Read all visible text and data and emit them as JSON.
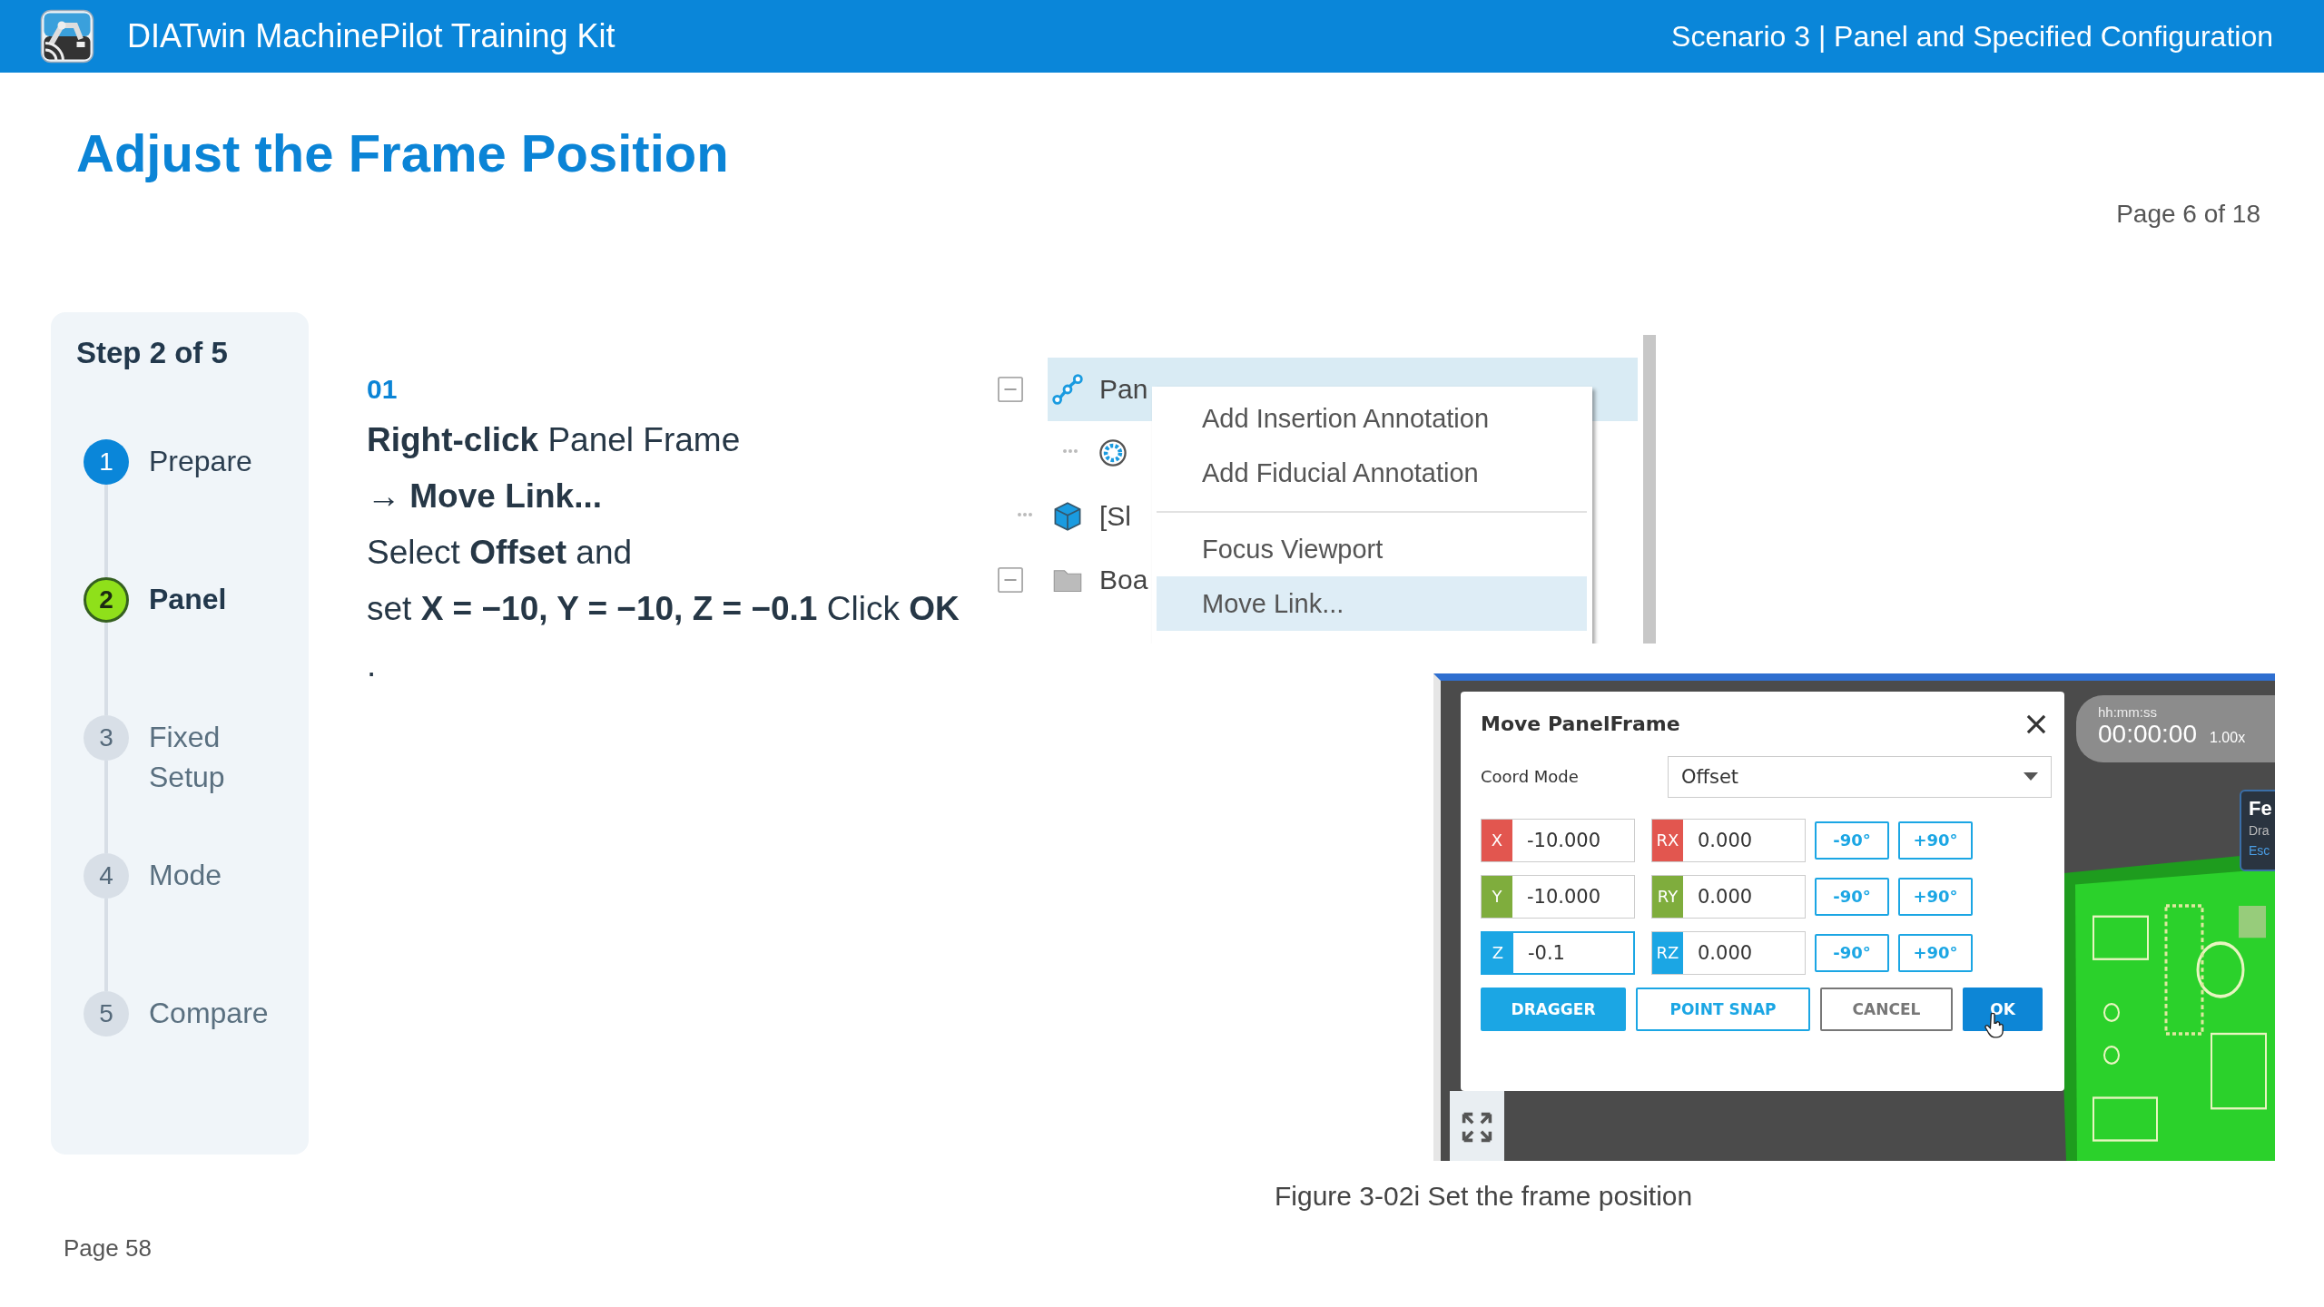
{
  "header": {
    "title": "DIATwin MachinePilot Training Kit",
    "scenario": "Scenario 3 | Panel and Specified Configuration"
  },
  "page_title": "Adjust the Frame Position",
  "page_indicator": "Page 6 of 18",
  "stepper": {
    "title": "Step 2 of 5",
    "steps": [
      {
        "number": "1",
        "label": "Prepare",
        "kind": "done"
      },
      {
        "number": "2",
        "label": "Panel",
        "kind": "current"
      },
      {
        "number": "3",
        "label": "Fixed Setup",
        "kind": "todo"
      },
      {
        "number": "4",
        "label": "Mode",
        "kind": "todo"
      },
      {
        "number": "5",
        "label": "Compare",
        "kind": "todo"
      }
    ]
  },
  "instruction": {
    "number": "01",
    "lines": [
      "**Right-click** Panel Frame",
      "→ **Move Link...**",
      "Select **Offset** and",
      "set **X = −10, Y = −10, Z = −0.1** Click **OK**",
      "."
    ]
  },
  "tree_figure": {
    "rows": [
      {
        "label": "Pan",
        "kind": "link",
        "expander": true,
        "selected": true,
        "children": [
          {
            "kind": "gear",
            "expander": false,
            "selected": false
          }
        ]
      },
      {
        "label": "[Sl",
        "kind": "cube",
        "expander": false,
        "selected": false
      },
      {
        "label": "Boa",
        "kind": "folder",
        "expander": true,
        "selected": false
      }
    ],
    "menu": [
      {
        "label": "Add Insertion Annotation",
        "selected": false,
        "separator_before": false
      },
      {
        "label": "Add Fiducial Annotation",
        "selected": false,
        "separator_before": false
      },
      {
        "label": "Focus Viewport",
        "selected": false,
        "separator_before": true
      },
      {
        "label": "Move Link...",
        "selected": true,
        "separator_before": false
      }
    ]
  },
  "dialog_figure": {
    "title": "Move PanelFrame",
    "coord_mode": {
      "label": "Coord Mode",
      "value": "Offset"
    },
    "axes": [
      {
        "axis": "X",
        "value": "-10.000",
        "color": "#e2564f",
        "focused": false,
        "rot_axis": "RX",
        "rot_value": "0.000",
        "minus": "-90°",
        "plus": "+90°"
      },
      {
        "axis": "Y",
        "value": "-10.000",
        "color": "#7fad3d",
        "focused": false,
        "rot_axis": "RY",
        "rot_value": "0.000",
        "minus": "-90°",
        "plus": "+90°"
      },
      {
        "axis": "Z",
        "value": "-0.1",
        "color": "#1ba6e4",
        "focused": true,
        "rot_axis": "RZ",
        "rot_value": "0.000",
        "minus": "-90°",
        "plus": "+90°"
      }
    ],
    "buttons": [
      {
        "label": "DRAGGER",
        "kind": "filled"
      },
      {
        "label": "POINT SNAP",
        "kind": "outline"
      },
      {
        "label": "CANCEL",
        "kind": "plain"
      },
      {
        "label": "OK",
        "kind": "primary"
      }
    ],
    "timer": {
      "format": "hh:mm:ss",
      "time": "00:00:00",
      "speed": "1.00x"
    },
    "side_panel": [
      "Fe",
      "Dra",
      "Esc"
    ]
  },
  "caption": "Figure 3-02i  Set the frame position",
  "footer": "Page 58"
}
